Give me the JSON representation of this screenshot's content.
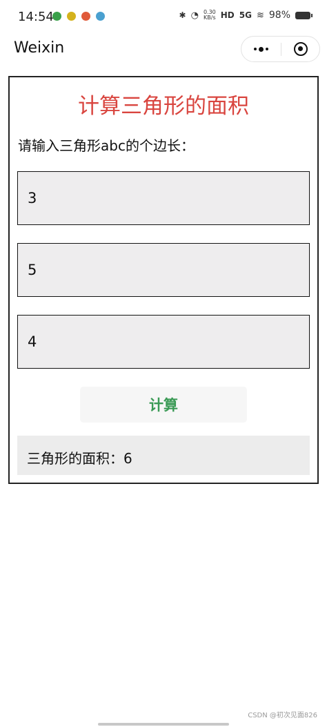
{
  "status_bar": {
    "time": "14:54",
    "network_speed_value": "0.30",
    "network_speed_unit": "KB/s",
    "hd_label": "HD",
    "signal_label": "5G",
    "battery": "98%",
    "notification_colors": [
      "#3aa04a",
      "#d4b21c",
      "#e05a3a",
      "#4aa0d0"
    ]
  },
  "nav": {
    "title": "Weixin"
  },
  "main": {
    "title": "计算三角形的面积",
    "title_color": "#d9453f",
    "prompt": "请输入三角形abc的个边长：",
    "inputs": [
      {
        "value": "3"
      },
      {
        "value": "5"
      },
      {
        "value": "4"
      }
    ],
    "button_label": "计算",
    "button_color": "#3a9a55",
    "result": "三角形的面积：6"
  },
  "footer": {
    "watermark": "CSDN @初次见面826"
  }
}
